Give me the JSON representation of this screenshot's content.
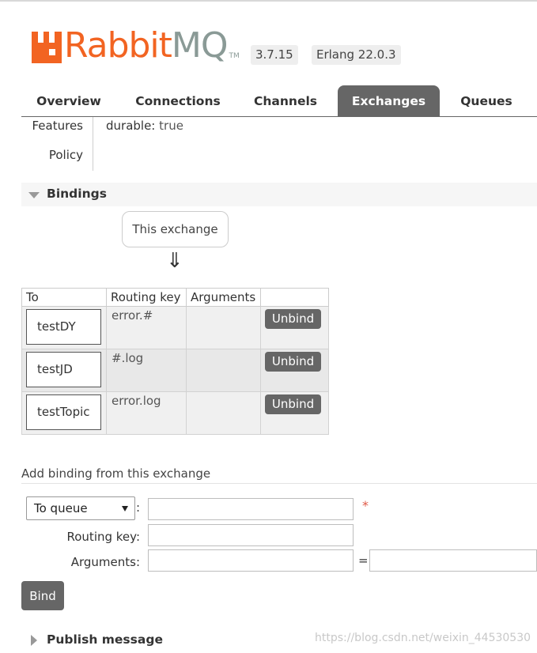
{
  "app": {
    "brand_orange": "Rabbit",
    "brand_gray": "MQ",
    "brand_tm": "TM",
    "version": "3.7.15",
    "erlang": "Erlang 22.0.3",
    "brand_color": "#f26422"
  },
  "tabs": [
    {
      "label": "Overview"
    },
    {
      "label": "Connections"
    },
    {
      "label": "Channels"
    },
    {
      "label": "Exchanges",
      "active": true
    },
    {
      "label": "Queues"
    }
  ],
  "props": {
    "features_label": "Features",
    "features_key": "durable:",
    "features_value": "true",
    "policy_label": "Policy"
  },
  "bindings": {
    "title": "Bindings",
    "this_exchange": "This exchange",
    "arrow": "⇓",
    "headers": [
      "To",
      "Routing key",
      "Arguments",
      ""
    ],
    "rows": [
      {
        "queue": "testDY",
        "routing_key": "error.#",
        "arguments": "",
        "action": "Unbind"
      },
      {
        "queue": "testJD",
        "routing_key": "#.log",
        "arguments": "",
        "action": "Unbind"
      },
      {
        "queue": "testTopic",
        "routing_key": "error.log",
        "arguments": "",
        "action": "Unbind"
      }
    ]
  },
  "add_binding": {
    "title": "Add binding from this exchange",
    "destination_type": "To queue",
    "colon": ":",
    "destination_value": "",
    "required_mark": "*",
    "routing_key_label": "Routing key:",
    "routing_key_value": "",
    "arguments_label": "Arguments:",
    "arguments_key": "",
    "equals": "=",
    "arguments_value": "",
    "bind_label": "Bind"
  },
  "publish": {
    "title": "Publish message"
  },
  "watermark": "https://blog.csdn.net/weixin_44530530"
}
